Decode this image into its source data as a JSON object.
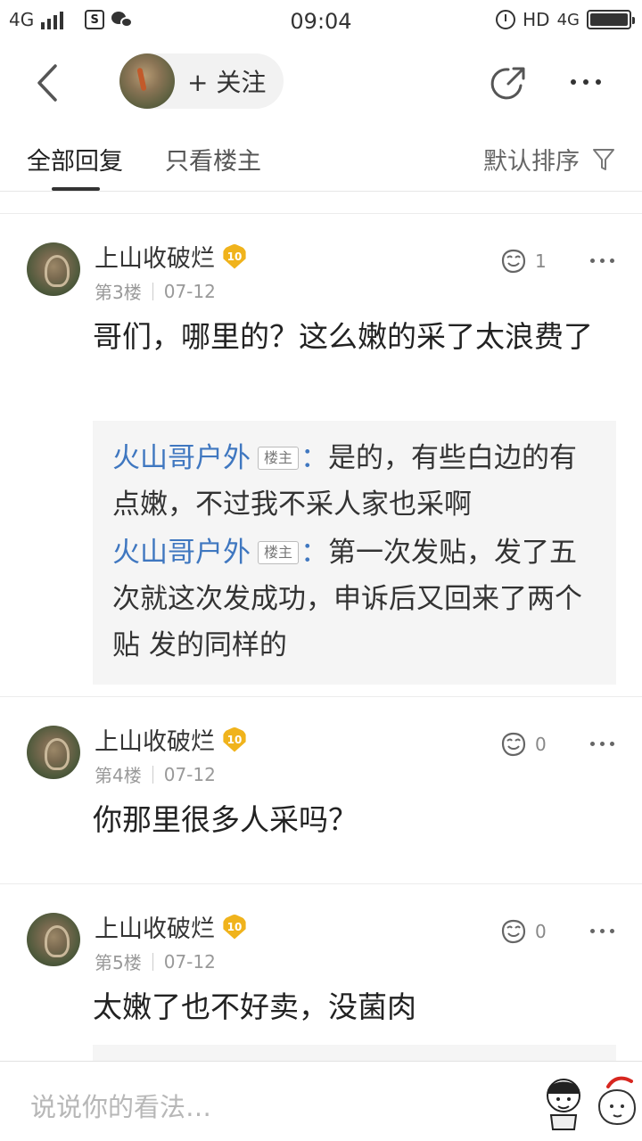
{
  "status_bar": {
    "network": "4G",
    "time": "09:04",
    "hd": "HD",
    "network_right": "4G",
    "app_badge": "S"
  },
  "nav": {
    "follow_label": "+ 关注",
    "back_icon": "chevron-left-icon",
    "share_icon": "share-icon",
    "more_icon": "more-icon"
  },
  "tabs": {
    "all": "全部回复",
    "owner_only": "只看楼主",
    "sort": "默认排序",
    "filter_icon": "filter-icon"
  },
  "posts": [
    {
      "username": "上山收破烂",
      "level": "10",
      "floor": "第3楼",
      "date": "07-12",
      "likes": "1",
      "content": "哥们，哪里的？这么嫩的采了太浪费了",
      "replies": [
        {
          "name": "火山哥户外",
          "tag": "楼主",
          "colon": "：",
          "text": "是的，有些白边的有点嫩，不过我不采人家也采啊"
        },
        {
          "name": "火山哥户外",
          "tag": "楼主",
          "colon": "：",
          "text": "第一次发贴，发了五次就这次发成功，申诉后又回来了两个贴 发的同样的"
        }
      ]
    },
    {
      "username": "上山收破烂",
      "level": "10",
      "floor": "第4楼",
      "date": "07-12",
      "likes": "0",
      "content": "你那里很多人采吗？"
    },
    {
      "username": "上山收破烂",
      "level": "10",
      "floor": "第5楼",
      "date": "07-12",
      "likes": "0",
      "content": "太嫩了也不好卖，没菌肉"
    }
  ],
  "bottom": {
    "placeholder": "说说你的看法…"
  },
  "colors": {
    "link_blue": "#3f77c0",
    "level_gold": "#f0b31c",
    "reply_bg": "#f5f5f5"
  }
}
